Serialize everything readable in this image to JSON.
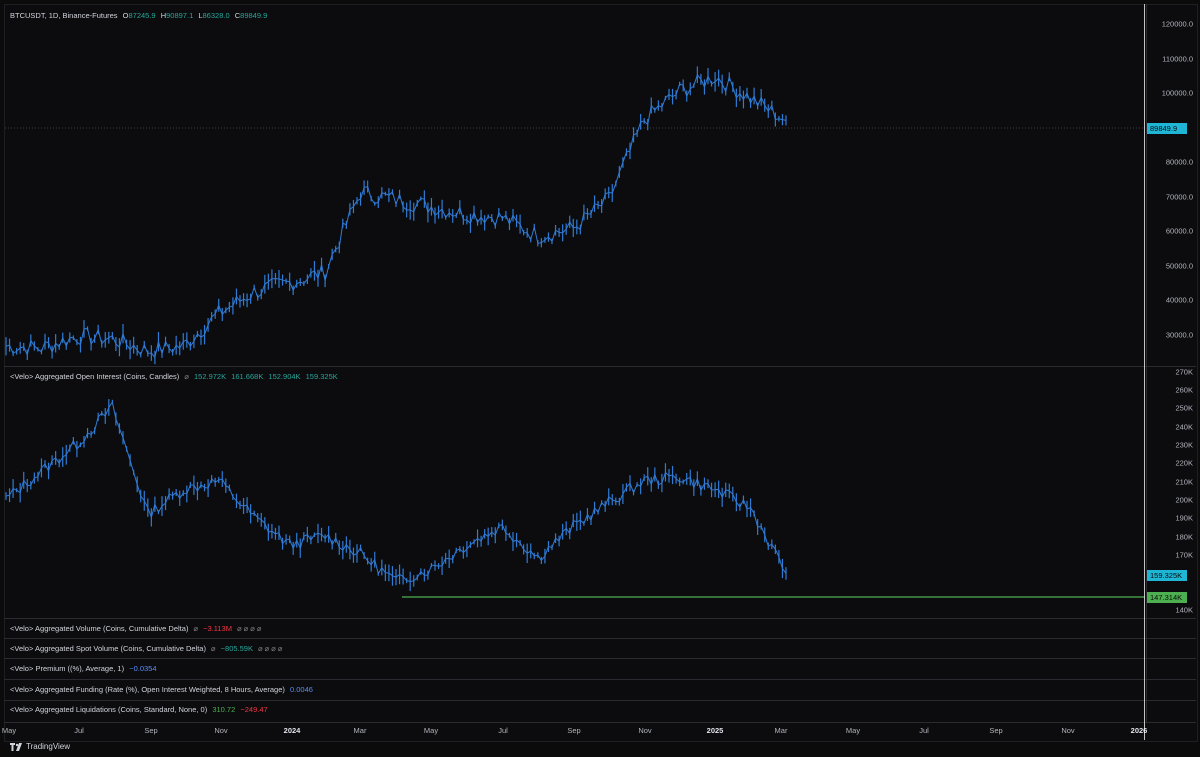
{
  "main": {
    "symbol": "BTCUSDT, 1D, Binance-Futures",
    "open_label": "O",
    "open": "87245.9",
    "high_label": "H",
    "high": "90897.1",
    "low_label": "L",
    "low": "86328.0",
    "close_label": "C",
    "close": "89849.9",
    "price_badge": "89849.9",
    "ticks": [
      "120000.0",
      "110000.0",
      "100000.0",
      "90000.0",
      "80000.0",
      "70000.0",
      "60000.0",
      "50000.0",
      "40000.0",
      "30000.0"
    ]
  },
  "oi": {
    "title": "<Velo> Aggregated Open Interest (Coins, Candles)",
    "icon": "hidden-eye-icon",
    "v1": "152.972K",
    "v2": "161.668K",
    "v3": "152.904K",
    "v4": "159.325K",
    "badge_current": "159.325K",
    "badge_level": "147.314K",
    "ticks": [
      "270K",
      "260K",
      "250K",
      "240K",
      "230K",
      "220K",
      "210K",
      "200K",
      "190K",
      "180K",
      "170K",
      "160K",
      "150K",
      "140K"
    ]
  },
  "indicators": [
    {
      "title": "<Velo> Aggregated Volume (Coins, Cumulative Delta)",
      "value": "−3.113M",
      "value_color": "#f23645",
      "trail": "⌀ ⌀ ⌀ ⌀"
    },
    {
      "title": "<Velo> Aggregated Spot Volume (Coins, Cumulative Delta)",
      "value": "−805.59K",
      "value_color": "#26a69a",
      "trail": "⌀ ⌀ ⌀ ⌀"
    },
    {
      "title": "<Velo> Premium ((%), Average, 1)",
      "value": "−0.0354",
      "value_color": "#5b8cf5",
      "trail": ""
    },
    {
      "title": "<Velo> Aggregated Funding (Rate (%), Open Interest Weighted, 8 Hours, Average)",
      "value": "0.0046",
      "value_color": "#5b8cf5",
      "trail": ""
    },
    {
      "title": "<Velo> Aggregated Liquidations (Coins, Standard, None, 0)",
      "value": "310.72",
      "value_color": "#4caf50",
      "value2": "−249.47",
      "value2_color": "#f23645",
      "trail": ""
    }
  ],
  "xaxis": [
    "May",
    "Jul",
    "Sep",
    "Nov",
    "2024",
    "Mar",
    "May",
    "Jul",
    "Sep",
    "Nov",
    "2025",
    "Mar",
    "May",
    "Jul",
    "Sep",
    "Nov",
    "2026"
  ],
  "brand": "TradingView",
  "colors": {
    "candle": "#2f7bd6",
    "accent": "#1fb5d4",
    "level": "#4caf50"
  },
  "chart_data": [
    {
      "type": "line",
      "title": "BTCUSDT, 1D, Binance-Futures",
      "x": [
        "2023-05",
        "2023-06",
        "2023-07",
        "2023-08",
        "2023-09",
        "2023-10",
        "2023-11",
        "2023-12",
        "2024-01",
        "2024-02",
        "2024-03",
        "2024-04",
        "2024-05",
        "2024-06",
        "2024-07",
        "2024-08",
        "2024-09",
        "2024-10",
        "2024-11",
        "2024-12",
        "2025-01",
        "2025-02",
        "2025-03"
      ],
      "series": [
        {
          "values": [
            27500,
            27000,
            30200,
            29500,
            26200,
            27500,
            36500,
            42500,
            45000,
            48000,
            70000,
            68000,
            66000,
            64000,
            63000,
            58000,
            60000,
            68000,
            90000,
            98000,
            102000,
            96000,
            89850
          ]
        }
      ],
      "ylim": [
        22000,
        122000
      ]
    },
    {
      "type": "line",
      "title": "<Velo> Aggregated Open Interest (Coins, Candles)",
      "x": [
        "2023-05",
        "2023-06",
        "2023-07",
        "2023-08",
        "2023-09",
        "2023-10",
        "2023-11",
        "2023-12",
        "2024-01",
        "2024-02",
        "2024-03",
        "2024-04",
        "2024-05",
        "2024-06",
        "2024-07",
        "2024-08",
        "2024-09",
        "2024-10",
        "2024-11",
        "2024-12",
        "2025-01",
        "2025-02",
        "2025-03"
      ],
      "series": [
        {
          "values": [
            200000,
            215000,
            230000,
            250000,
            192000,
            205000,
            210000,
            190000,
            175000,
            180000,
            170000,
            155000,
            162000,
            175000,
            185000,
            168000,
            185000,
            198000,
            210000,
            212000,
            205000,
            195000,
            159325
          ]
        }
      ],
      "ylim": [
        135000,
        272000
      ]
    }
  ]
}
